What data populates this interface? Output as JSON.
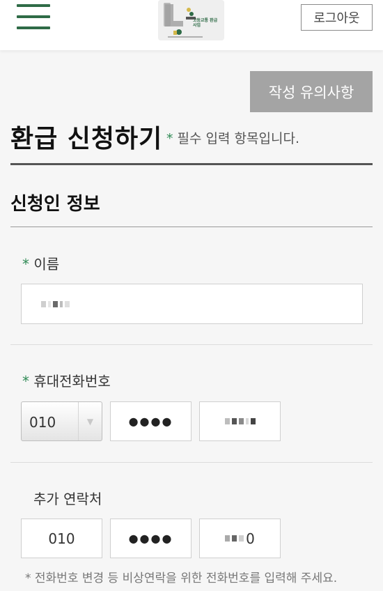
{
  "header": {
    "logout_label": "로그아웃",
    "logo_text": "고등교통 환급사업"
  },
  "notice_button_label": "작성 유의사항",
  "page_title": "환급 신청하기",
  "required_note": {
    "star": "*",
    "text": "필수 입력 항목입니다."
  },
  "section_title": "신청인 정보",
  "fields": {
    "name": {
      "required": "*",
      "label": "이름",
      "value_masked": true
    },
    "phone": {
      "required": "*",
      "label": "휴대전화번호",
      "prefix_selected": "010",
      "middle": "●●●●",
      "last_masked": true
    },
    "extra_contact": {
      "label": "추가 연락처",
      "prefix": "010",
      "middle": "●●●●",
      "last_suffix": "0"
    }
  },
  "help_text": "* 전화번호 변경 등 비상연락을 위한 전화번호를 입력해 주세요.",
  "colors": {
    "accent_green": "#2f6b47",
    "required_star": "#2f8a55",
    "notice_button_bg": "#a4a4a4"
  }
}
